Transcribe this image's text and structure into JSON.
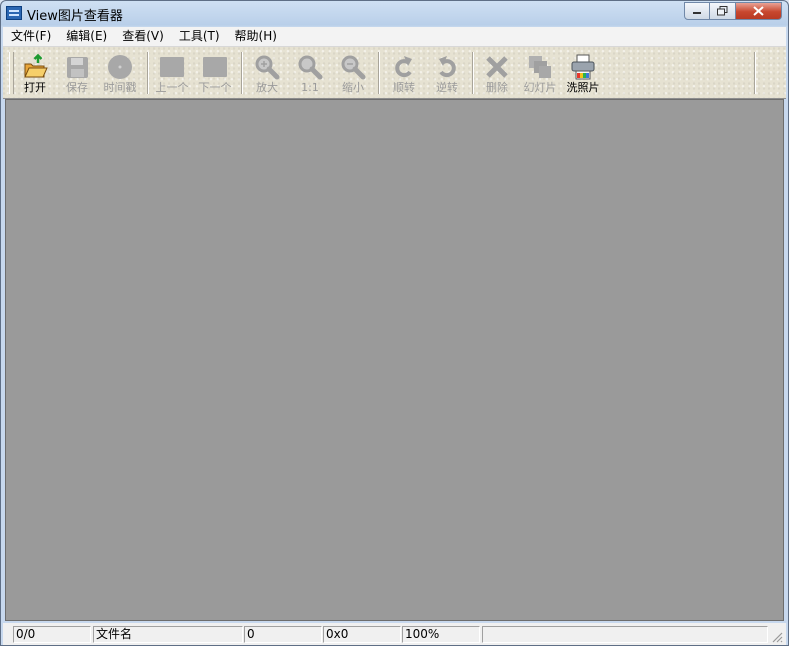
{
  "window": {
    "title": "View图片查看器",
    "controls": {
      "minimize": "▭",
      "maximize": "□",
      "close": "✕"
    }
  },
  "menu": [
    {
      "label": "文件(F)"
    },
    {
      "label": "编辑(E)"
    },
    {
      "label": "查看(V)"
    },
    {
      "label": "工具(T)"
    },
    {
      "label": "帮助(H)"
    }
  ],
  "toolbar": {
    "buttons": [
      {
        "label": "打开",
        "icon": "open-folder-icon",
        "enabled": true
      },
      {
        "label": "保存",
        "icon": "save-disk-icon",
        "enabled": false
      },
      {
        "label": "时间戳",
        "icon": "timestamp-circle-icon",
        "enabled": false
      },
      {
        "label": "上一个",
        "icon": "previous-image-icon",
        "enabled": false
      },
      {
        "label": "下一个",
        "icon": "next-image-icon",
        "enabled": false
      },
      {
        "label": "放大",
        "icon": "zoom-in-icon",
        "enabled": false
      },
      {
        "label": "1:1",
        "icon": "actual-size-icon",
        "enabled": false
      },
      {
        "label": "缩小",
        "icon": "zoom-out-icon",
        "enabled": false
      },
      {
        "label": "顺转",
        "icon": "rotate-clockwise-icon",
        "enabled": false
      },
      {
        "label": "逆转",
        "icon": "rotate-counterclockwise-icon",
        "enabled": false
      },
      {
        "label": "删除",
        "icon": "delete-x-icon",
        "enabled": false
      },
      {
        "label": "幻灯片",
        "icon": "slideshow-icon",
        "enabled": false
      },
      {
        "label": "洗照片",
        "icon": "print-photo-icon",
        "enabled": true
      }
    ]
  },
  "statusbar": {
    "index": "0/0",
    "filename": "文件名",
    "filesize": "0",
    "dimensions": "0x0",
    "zoom": "100%",
    "extra": ""
  },
  "colors": {
    "viewport_bg": "#9a9a9a",
    "toolbar_bg": "#e6e2d2",
    "disabled_icon": "#a8a8a8",
    "close_button": "#c8472e"
  }
}
